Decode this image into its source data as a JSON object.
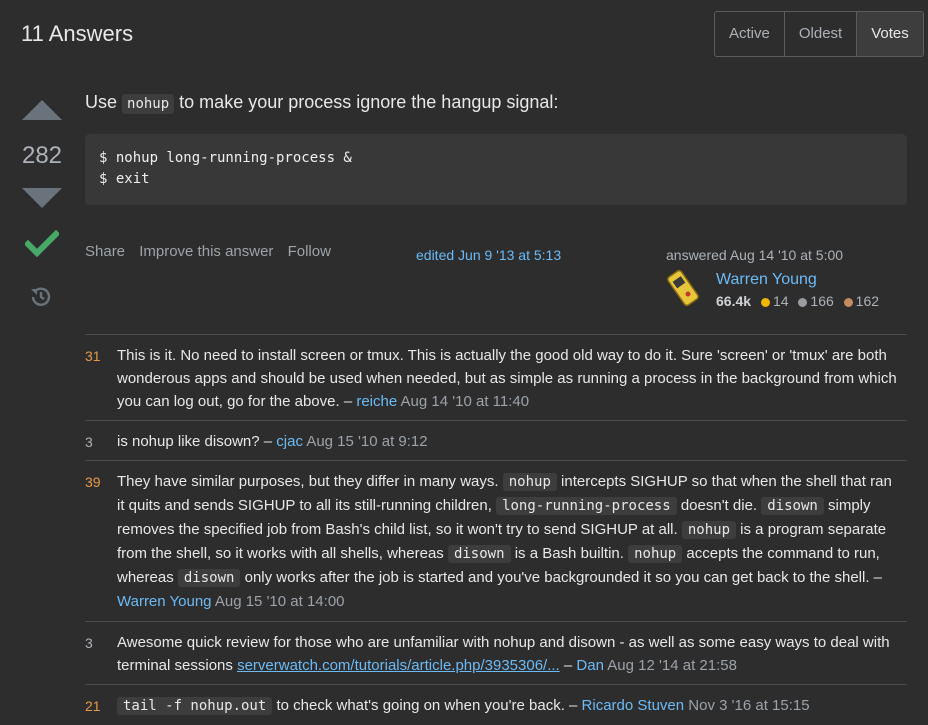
{
  "header": {
    "title": "11 Answers",
    "sort_options": [
      "Active",
      "Oldest",
      "Votes"
    ],
    "active_sort": "Votes"
  },
  "vote": {
    "count": "282",
    "accepted": true
  },
  "answer": {
    "text_before": "Use ",
    "inline_code": "nohup",
    "text_after": " to make your process ignore the hangup signal:",
    "code_lines": [
      "$ nohup long-running-process &",
      "$ exit"
    ]
  },
  "post_menu": {
    "share": "Share",
    "improve": "Improve this answer",
    "follow": "Follow"
  },
  "edited": "edited Jun 9 '13 at 5:13",
  "answered": {
    "label": "answered Aug 14 '10 at 5:00",
    "user": "Warren Young",
    "reputation": "66.4k",
    "gold": "14",
    "silver": "166",
    "bronze": "162"
  },
  "comments": [
    {
      "score": "31",
      "text": "This is it. No need to install screen or tmux. This is actually the good old way to do it. Sure 'screen' or 'tmux' are both wonderous apps and should be used when needed, but as simple as running a process in the background from which you can log out, go for the above. –",
      "user": "reiche",
      "date": "Aug 14 '10 at 11:40"
    },
    {
      "score": "3",
      "text": "is nohup like disown? –",
      "user": "cjac",
      "date": "Aug 15 '10 at 9:12"
    },
    {
      "score": "39",
      "parts": [
        "They have similar purposes, but they differ in many ways. ",
        "nohup",
        " intercepts SIGHUP so that when the shell that ran it quits and sends SIGHUP to all its still-running children, ",
        "long-running-process",
        " doesn't die. ",
        "disown",
        " simply removes the specified job from Bash's child list, so it won't try to send SIGHUP at all. ",
        "nohup",
        " is a program separate from the shell, so it works with all shells, whereas ",
        "disown",
        " is a Bash builtin. ",
        "nohup",
        " accepts the command to run, whereas ",
        "disown",
        " only works after the job is started and you've backgrounded it so you can get back to the shell. –"
      ],
      "user": "Warren Young",
      "date": "Aug 15 '10 at 14:00"
    },
    {
      "score": "3",
      "text": "Awesome quick review for those who are unfamiliar with nohup and disown - as well as some easy ways to deal with terminal sessions",
      "link": "serverwatch.com/tutorials/article.php/3935306/...",
      "tail": "–",
      "user": "Dan",
      "date": "Aug 12 '14 at 21:58"
    },
    {
      "score": "21",
      "code": "tail -f nohup.out",
      "text": " to check what's going on when you're back. –",
      "user": "Ricardo Stuven",
      "date": "Nov 3 '16 at 15:15"
    }
  ]
}
